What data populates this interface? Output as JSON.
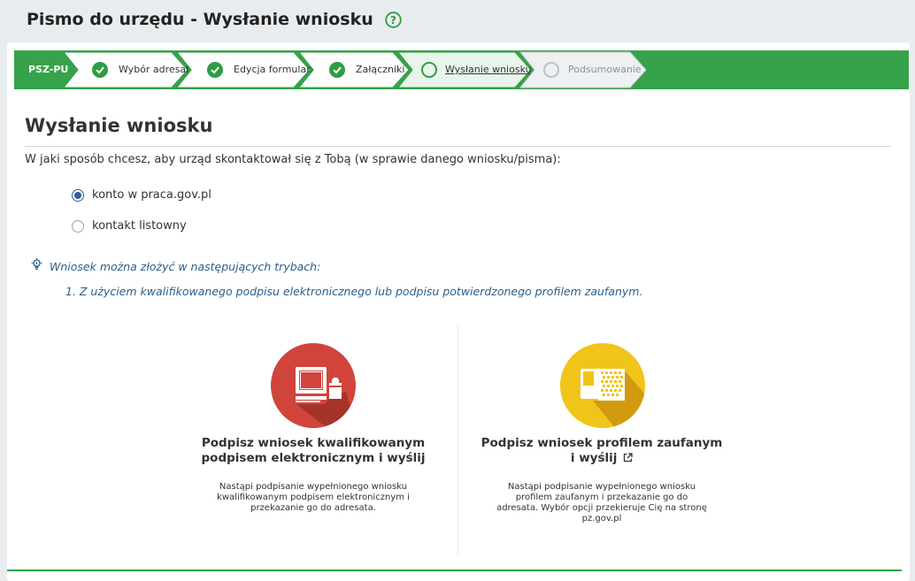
{
  "header": {
    "title": "Pismo do urzędu - Wysłanie wniosku"
  },
  "stepper": {
    "code": "PSZ-PU",
    "steps": [
      {
        "label": "Wybór adresata",
        "state": "done"
      },
      {
        "label": "Edycja formularza",
        "state": "done"
      },
      {
        "label": "Załączniki",
        "state": "done"
      },
      {
        "label": "Wysłanie wniosku",
        "state": "current"
      },
      {
        "label": "Podsumowanie",
        "state": "pending"
      }
    ]
  },
  "section": {
    "title": "Wysłanie wniosku",
    "question": "W jaki sposób chcesz, aby urząd skontaktował się z Tobą (w sprawie danego wniosku/pisma):"
  },
  "contact_options": [
    {
      "label": "konto w praca.gov.pl",
      "checked": true
    },
    {
      "label": "kontakt listowny",
      "checked": false
    }
  ],
  "info": {
    "text": "Wniosek można złożyć w następujących trybach:",
    "item": "1. Z użyciem kwalifikowanego podpisu elektronicznego lub podpisu potwierdzonego profilem zaufanym."
  },
  "sign_options": [
    {
      "title_line1": "Podpisz wniosek kwalifikowanym",
      "title_line2": "podpisem elektronicznym i wyślij",
      "desc": "Nastąpi podpisanie wypełnionego wniosku kwalifikowanym podpisem elektronicznym i przekazanie go do adresata.",
      "icon": "computer-signature-icon",
      "color": "#d0443b"
    },
    {
      "title_line1": "Podpisz wniosek profilem zaufanym",
      "title_line2": "i wyślij",
      "desc": "Nastąpi podpisanie wypełnionego wniosku profilem zaufanym i przekazanie go do adresata. Wybór opcji przekieruje Cię na stronę pz.gov.pl",
      "icon": "trusted-profile-icon",
      "color": "#f0c419"
    }
  ],
  "colors": {
    "accent": "#36a249",
    "info": "#2a5f8c",
    "radio": "#2f5f93"
  }
}
